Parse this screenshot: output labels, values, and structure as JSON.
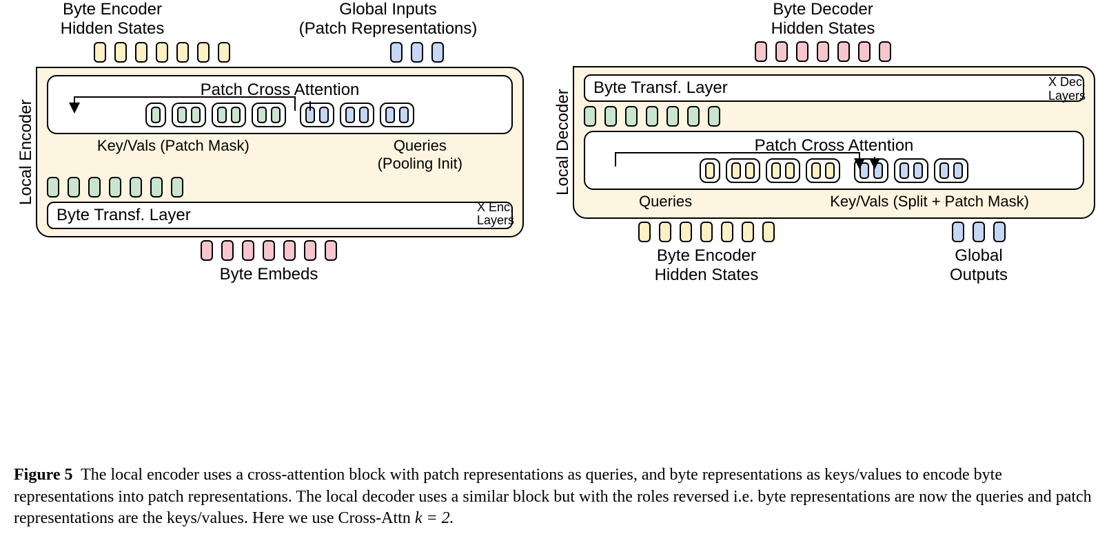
{
  "figure_label": "Figure 5",
  "caption_text": "The local encoder uses a cross-attention block with patch representations as queries, and byte representations as keys/values to encode byte representations into patch representations. The local decoder uses a similar block but with the roles reversed i.e. byte representations are now the queries and patch representations are the keys/values. Here we use Cross-Attn ",
  "caption_math": "k = 2.",
  "encoder": {
    "side": "Local Encoder",
    "top_left": "Byte Encoder\nHidden States",
    "top_right": "Global Inputs\n(Patch Representations)",
    "cross_title": "Patch Cross Attention",
    "under_left": "Key/Vals (Patch Mask)",
    "under_right": "Queries\n(Pooling Init)",
    "layer": "Byte Transf. Layer",
    "note": "X Enc.\nLayers",
    "bottom": "Byte Embeds"
  },
  "decoder": {
    "side": "Local Decoder",
    "top": "Byte Decoder\nHidden States",
    "layer": "Byte Transf. Layer",
    "note": "X Dec.\nLayers",
    "cross_title": "Patch Cross Attention",
    "under_left": "Queries",
    "under_right": "Key/Vals (Split + Patch Mask)",
    "bottom_left": "Byte Encoder\nHidden States",
    "bottom_right": "Global\nOutputs"
  },
  "chart_data": {
    "type": "diagram",
    "cross_attn_k": 2,
    "encoder": {
      "module": "Local Encoder",
      "top_tokens_byte_hidden": 7,
      "top_tokens_global_inputs": 3,
      "cross_attention": {
        "kv_groups": [
          1,
          2,
          2,
          2
        ],
        "kv_color": "green",
        "query_groups": [
          2,
          2,
          2
        ],
        "query_color": "blue"
      },
      "mid_tokens_green": 7,
      "bottom_tokens_pink": 7,
      "layers": "X Enc. Layers"
    },
    "decoder": {
      "module": "Local Decoder",
      "top_tokens_pink": 7,
      "mid_tokens_green": 7,
      "cross_attention": {
        "query_groups": [
          1,
          2,
          2,
          2
        ],
        "query_color": "yellow",
        "kv_groups": [
          2,
          2,
          2
        ],
        "kv_color": "blue"
      },
      "bottom_tokens_yellow": 7,
      "bottom_tokens_blue": 3,
      "layers": "X Dec. Layers"
    }
  }
}
